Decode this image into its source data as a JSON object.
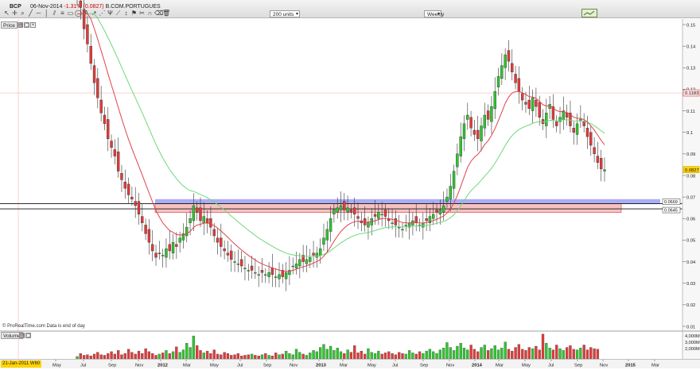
{
  "header": {
    "ticker": "BCP",
    "quote_date": "06-Nov-2014",
    "change": "-1.31%",
    "last_price": "(0.0827)",
    "company": "B.COM.PORTUGUES",
    "units_select": "200 units",
    "period_select": "Weekly"
  },
  "panels": {
    "price_label": "Price",
    "volume_label": "Volume",
    "copyright": "© ProRealTime.com  Data is end of day",
    "cursor_date": "21-Jan-2011 W60"
  },
  "colors": {
    "up": "#2fc42f",
    "down": "#e23a3a",
    "ema_short": "#e0424a",
    "ema_long": "#6ed97a",
    "support_zone": "#8d92f0",
    "support_zone2": "#f5b3b3"
  },
  "chart_data": {
    "type": "candlestick",
    "timeframe": "Weekly",
    "y_ticks": [
      "0.15",
      "0.14",
      "0.13",
      "0.12",
      "0.11",
      "0.1",
      "0.09",
      "0.08",
      "0.07",
      "0.06",
      "0.05",
      "0.04",
      "0.03",
      "0.02",
      "0.01"
    ],
    "ylim": [
      0.01,
      0.15
    ],
    "x_ticks": [
      "May",
      "Jul",
      "Sep",
      "Nov",
      "2012",
      "Mar",
      "May",
      "Jul",
      "Sep",
      "Nov",
      "2013",
      "Mar",
      "May",
      "Jul",
      "Sep",
      "Nov",
      "2014",
      "Mar",
      "May",
      "Jul",
      "Sep",
      "Nov",
      "2015",
      "Mar"
    ],
    "volume_ticks": [
      "4,000M",
      "3,000M",
      "2,000M"
    ],
    "markers": {
      "price_marker": "0.1183",
      "last_marker": "0.0827",
      "line_1": "0.0669",
      "line_2": "0.0645"
    },
    "zones": [
      {
        "name": "support-zone-blue",
        "from": 0.0669,
        "to": 0.069
      },
      {
        "name": "support-zone-red",
        "from": 0.0628,
        "to": 0.0669
      }
    ],
    "horizontal_lines": [
      0.1183,
      0.0669,
      0.0645
    ],
    "weekly_closes": [
      0.162,
      0.158,
      0.148,
      0.141,
      0.132,
      0.123,
      0.116,
      0.109,
      0.104,
      0.097,
      0.093,
      0.089,
      0.082,
      0.078,
      0.074,
      0.071,
      0.069,
      0.066,
      0.062,
      0.058,
      0.053,
      0.049,
      0.045,
      0.042,
      0.044,
      0.043,
      0.046,
      0.045,
      0.049,
      0.047,
      0.051,
      0.053,
      0.056,
      0.06,
      0.066,
      0.063,
      0.059,
      0.061,
      0.058,
      0.056,
      0.052,
      0.049,
      0.047,
      0.045,
      0.043,
      0.041,
      0.04,
      0.039,
      0.038,
      0.037,
      0.036,
      0.036,
      0.035,
      0.034,
      0.035,
      0.034,
      0.035,
      0.034,
      0.033,
      0.034,
      0.033,
      0.035,
      0.036,
      0.038,
      0.039,
      0.041,
      0.04,
      0.041,
      0.042,
      0.043,
      0.044,
      0.046,
      0.051,
      0.055,
      0.06,
      0.064,
      0.065,
      0.066,
      0.064,
      0.065,
      0.063,
      0.062,
      0.06,
      0.058,
      0.057,
      0.058,
      0.06,
      0.061,
      0.063,
      0.062,
      0.061,
      0.059,
      0.058,
      0.057,
      0.056,
      0.055,
      0.057,
      0.058,
      0.059,
      0.058,
      0.057,
      0.058,
      0.059,
      0.061,
      0.062,
      0.063,
      0.064,
      0.066,
      0.07,
      0.075,
      0.082,
      0.09,
      0.098,
      0.104,
      0.108,
      0.102,
      0.099,
      0.097,
      0.103,
      0.108,
      0.106,
      0.112,
      0.119,
      0.126,
      0.131,
      0.136,
      0.133,
      0.128,
      0.123,
      0.119,
      0.115,
      0.113,
      0.111,
      0.116,
      0.112,
      0.107,
      0.104,
      0.109,
      0.113,
      0.106,
      0.103,
      0.107,
      0.11,
      0.107,
      0.103,
      0.1,
      0.104,
      0.106,
      0.103,
      0.098,
      0.094,
      0.09,
      0.086,
      0.083,
      0.0827
    ],
    "weekly_volumes": [
      0.4,
      0.9,
      0.6,
      0.7,
      0.5,
      0.8,
      1.1,
      0.7,
      0.6,
      0.9,
      1.2,
      0.8,
      1.4,
      0.7,
      0.9,
      1.6,
      1.1,
      0.8,
      1.3,
      0.9,
      1.7,
      1.2,
      0.9,
      0.6,
      0.8,
      1.0,
      1.4,
      0.9,
      1.2,
      2.0,
      1.1,
      1.5,
      2.6,
      1.9,
      3.8,
      2.2,
      1.4,
      1.0,
      1.3,
      0.9,
      1.5,
      0.8,
      0.7,
      1.1,
      0.9,
      0.6,
      0.7,
      0.9,
      0.5,
      0.6,
      0.7,
      0.8,
      0.6,
      0.5,
      0.7,
      0.9,
      0.6,
      0.5,
      1.0,
      0.7,
      0.8,
      1.3,
      0.9,
      0.7,
      1.6,
      1.1,
      0.8,
      0.6,
      1.0,
      1.4,
      1.2,
      1.9,
      2.4,
      1.6,
      2.1,
      1.4,
      1.8,
      1.2,
      0.9,
      1.5,
      1.1,
      2.2,
      1.0,
      1.3,
      0.8,
      1.7,
      1.1,
      0.9,
      1.3,
      0.8,
      1.0,
      1.2,
      0.9,
      0.7,
      1.1,
      0.9,
      0.8,
      1.4,
      1.0,
      0.8,
      1.2,
      0.9,
      1.3,
      1.6,
      1.2,
      0.9,
      1.5,
      1.8,
      2.7,
      1.9,
      1.4,
      2.1,
      2.6,
      1.8,
      1.5,
      2.3,
      1.6,
      1.2,
      1.9,
      2.3,
      1.4,
      1.7,
      2.2,
      1.5,
      1.8,
      2.8,
      1.6,
      1.3,
      1.9,
      2.4,
      1.6,
      1.4,
      1.9,
      1.7,
      2.1,
      1.5,
      4.1,
      2.6,
      1.8,
      1.5,
      2.3,
      1.7,
      1.4,
      1.9,
      2.2,
      1.6,
      1.5,
      1.8,
      2.3,
      1.5,
      1.9,
      1.7,
      1.6
    ]
  }
}
